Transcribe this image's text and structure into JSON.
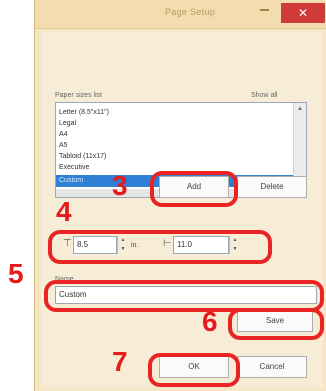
{
  "dialog": {
    "title": "Page Setup",
    "close_glyph": "✕"
  },
  "list": {
    "label_left": "Paper sizes list",
    "label_right": "Show all",
    "items": [
      "Letter (8.5\"x11\")",
      "Legal",
      "A4",
      "A5",
      "Tabloid (11x17)",
      "Executive",
      "Custom"
    ],
    "selected_index": 6
  },
  "buttons": {
    "add": "Add",
    "delete": "Delete",
    "save": "Save",
    "ok": "OK",
    "cancel": "Cancel"
  },
  "size_fields": {
    "width_value": "8.5",
    "unit": "in.",
    "height_value": "11.0"
  },
  "name_field": {
    "label": "Name",
    "value": "Custom"
  },
  "steps": {
    "s3": "3",
    "s4": "4",
    "s5": "5",
    "s6": "6",
    "s7": "7"
  },
  "colors": {
    "annotation_red": "#e51a1a",
    "dialog_bg": "#f7edd6",
    "selection_blue": "#2f7fd6"
  },
  "icons": [
    "minimize-icon",
    "close-icon",
    "scroll-up-icon",
    "scroll-down-icon",
    "width-icon",
    "height-icon",
    "spin-arrows-icon"
  ]
}
